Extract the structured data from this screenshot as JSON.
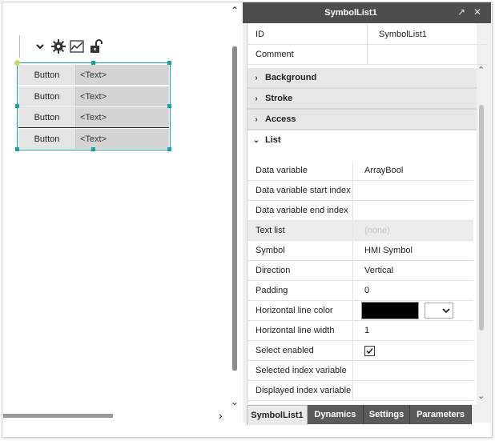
{
  "canvas": {
    "toolbar": {
      "dropdown_icon": "chevron-down-icon",
      "settings_icon": "gear-icon",
      "trend_icon": "trend-icon",
      "lock_icon": "unlock-icon"
    },
    "symbol_list": {
      "rows": [
        {
          "button": "Button",
          "text": "<Text>"
        },
        {
          "button": "Button",
          "text": "<Text>"
        },
        {
          "button": "Button",
          "text": "<Text>"
        },
        {
          "button": "Button",
          "text": "<Text>"
        }
      ]
    },
    "scroll": {
      "up": "⌃",
      "down": "⌄",
      "right": "›"
    }
  },
  "panel": {
    "title": "SymbolList1",
    "title_icons": {
      "pin": "↗",
      "close": "✕"
    },
    "top_rows": [
      {
        "label": "ID",
        "value": "SymbolList1"
      },
      {
        "label": "Comment",
        "value": ""
      }
    ],
    "groups": [
      {
        "chevron": "›",
        "label": "Background"
      },
      {
        "chevron": "›",
        "label": "Stroke"
      },
      {
        "chevron": "›",
        "label": "Access"
      },
      {
        "chevron": "⌄",
        "label": "List"
      }
    ],
    "list_rows": [
      {
        "label": "Data variable",
        "value": "ArrayBool"
      },
      {
        "label": "Data variable start index",
        "value": ""
      },
      {
        "label": "Data variable end index",
        "value": ""
      },
      {
        "label": "Text list",
        "value": "(none)"
      },
      {
        "label": "Symbol",
        "value": "HMI Symbol"
      },
      {
        "label": "Direction",
        "value": "Vertical"
      },
      {
        "label": "Padding",
        "value": "0"
      },
      {
        "label": "Horizontal line color",
        "value": ""
      },
      {
        "label": "Horizontal line width",
        "value": "1"
      },
      {
        "label": "Select enabled",
        "value": ""
      },
      {
        "label": "Selected index variable",
        "value": ""
      },
      {
        "label": "Displayed index variable",
        "value": ""
      }
    ],
    "line_color": "#000000",
    "select_enabled": true,
    "tabs": [
      "SymbolList1",
      "Dynamics",
      "Settings",
      "Parameters"
    ]
  }
}
